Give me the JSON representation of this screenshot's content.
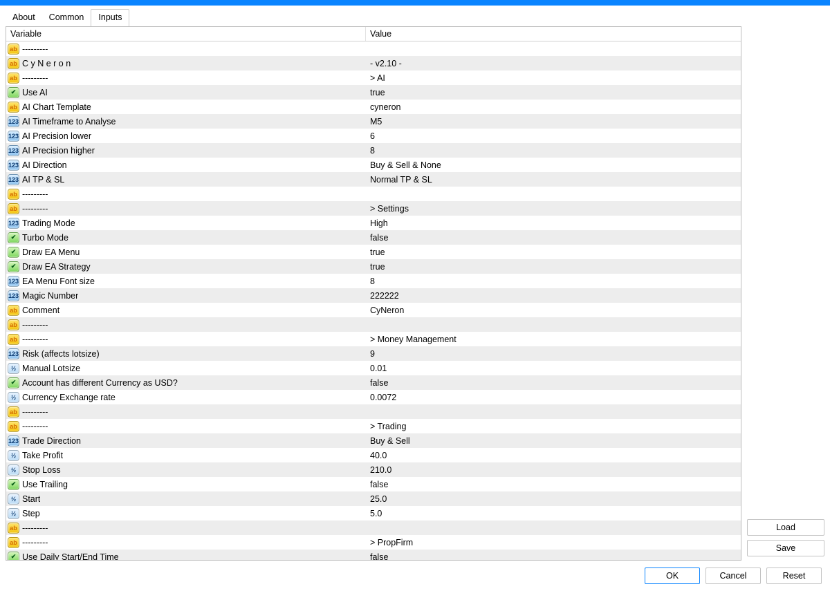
{
  "tabs": {
    "about": "About",
    "common": "Common",
    "inputs": "Inputs",
    "active": "inputs"
  },
  "headers": {
    "variable": "Variable",
    "value": "Value"
  },
  "icon_glyphs": {
    "ab": "ab",
    "num": "123",
    "dbl": "½",
    "bool": "✔"
  },
  "rows": [
    {
      "icon": "ab",
      "name": "---------",
      "value": ""
    },
    {
      "icon": "ab",
      "name": "C y N e r o n",
      "value": "-   v2.10   -"
    },
    {
      "icon": "ab",
      "name": "---------",
      "value": " > AI"
    },
    {
      "icon": "bool",
      "name": "Use AI",
      "value": "true"
    },
    {
      "icon": "ab",
      "name": "AI Chart Template",
      "value": "cyneron"
    },
    {
      "icon": "num",
      "name": "AI Timeframe to Analyse",
      "value": "M5"
    },
    {
      "icon": "num",
      "name": "AI Precision lower",
      "value": "6"
    },
    {
      "icon": "num",
      "name": "AI Precision higher",
      "value": "8"
    },
    {
      "icon": "num",
      "name": "AI Direction",
      "value": "Buy & Sell & None"
    },
    {
      "icon": "num",
      "name": "AI TP & SL",
      "value": "Normal TP & SL"
    },
    {
      "icon": "ab",
      "name": "---------",
      "value": ""
    },
    {
      "icon": "ab",
      "name": "---------",
      "value": " > Settings"
    },
    {
      "icon": "num",
      "name": "Trading Mode",
      "value": "High"
    },
    {
      "icon": "bool",
      "name": "Turbo Mode",
      "value": "false"
    },
    {
      "icon": "bool",
      "name": "Draw EA Menu",
      "value": "true"
    },
    {
      "icon": "bool",
      "name": "Draw EA Strategy",
      "value": "true"
    },
    {
      "icon": "num",
      "name": "EA Menu Font size",
      "value": "8"
    },
    {
      "icon": "num",
      "name": "Magic Number",
      "value": "222222"
    },
    {
      "icon": "ab",
      "name": "Comment",
      "value": "CyNeron"
    },
    {
      "icon": "ab",
      "name": "---------",
      "value": ""
    },
    {
      "icon": "ab",
      "name": "---------",
      "value": " > Money Management"
    },
    {
      "icon": "num",
      "name": "Risk (affects lotsize)",
      "value": "9"
    },
    {
      "icon": "dbl",
      "name": "Manual Lotsize",
      "value": "0.01"
    },
    {
      "icon": "bool",
      "name": "Account has different Currency as USD?",
      "value": "false"
    },
    {
      "icon": "dbl",
      "name": "Currency Exchange rate",
      "value": "0.0072"
    },
    {
      "icon": "ab",
      "name": "---------",
      "value": ""
    },
    {
      "icon": "ab",
      "name": "---------",
      "value": " > Trading"
    },
    {
      "icon": "num",
      "name": "Trade Direction",
      "value": "Buy & Sell"
    },
    {
      "icon": "dbl",
      "name": "Take Profit",
      "value": "40.0"
    },
    {
      "icon": "dbl",
      "name": "Stop Loss",
      "value": "210.0"
    },
    {
      "icon": "bool",
      "name": "Use Trailing",
      "value": "false"
    },
    {
      "icon": "dbl",
      "name": "Start",
      "value": "25.0"
    },
    {
      "icon": "dbl",
      "name": "Step",
      "value": "5.0"
    },
    {
      "icon": "ab",
      "name": "---------",
      "value": ""
    },
    {
      "icon": "ab",
      "name": "---------",
      "value": " > PropFirm"
    },
    {
      "icon": "bool",
      "name": "Use Daily Start/End Time",
      "value": "false"
    }
  ],
  "side_buttons": {
    "load": "Load",
    "save": "Save"
  },
  "footer_buttons": {
    "ok": "OK",
    "cancel": "Cancel",
    "reset": "Reset"
  }
}
